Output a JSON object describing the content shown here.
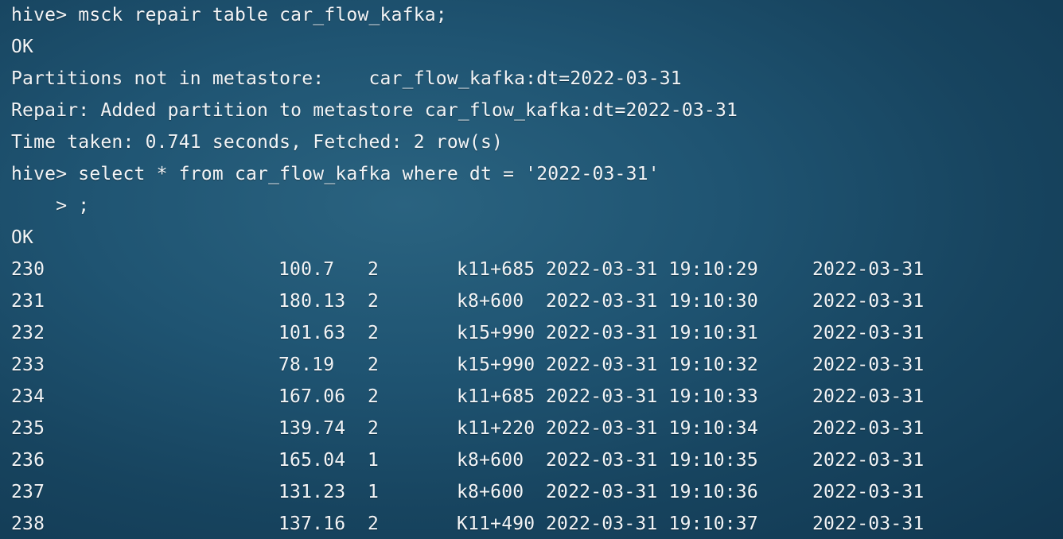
{
  "lines": [
    "hive> msck repair table car_flow_kafka;",
    "OK",
    "Partitions not in metastore:    car_flow_kafka:dt=2022-03-31",
    "Repair: Added partition to metastore car_flow_kafka:dt=2022-03-31",
    "Time taken: 0.741 seconds, Fetched: 2 row(s)",
    "hive> select * from car_flow_kafka where dt = '2022-03-31'",
    "    > ;",
    "OK"
  ],
  "rows": [
    {
      "id": "230",
      "speed": "100.7",
      "lane": "2",
      "location": "k11+685",
      "time": "2022-03-31 19:10:29",
      "dt": "2022-03-31"
    },
    {
      "id": "231",
      "speed": "180.13",
      "lane": "2",
      "location": "k8+600",
      "time": "2022-03-31 19:10:30",
      "dt": "2022-03-31"
    },
    {
      "id": "232",
      "speed": "101.63",
      "lane": "2",
      "location": "k15+990",
      "time": "2022-03-31 19:10:31",
      "dt": "2022-03-31"
    },
    {
      "id": "233",
      "speed": "78.19",
      "lane": "2",
      "location": "k15+990",
      "time": "2022-03-31 19:10:32",
      "dt": "2022-03-31"
    },
    {
      "id": "234",
      "speed": "167.06",
      "lane": "2",
      "location": "k11+685",
      "time": "2022-03-31 19:10:33",
      "dt": "2022-03-31"
    },
    {
      "id": "235",
      "speed": "139.74",
      "lane": "2",
      "location": "k11+220",
      "time": "2022-03-31 19:10:34",
      "dt": "2022-03-31"
    },
    {
      "id": "236",
      "speed": "165.04",
      "lane": "1",
      "location": "k8+600",
      "time": "2022-03-31 19:10:35",
      "dt": "2022-03-31"
    },
    {
      "id": "237",
      "speed": "131.23",
      "lane": "1",
      "location": "k8+600",
      "time": "2022-03-31 19:10:36",
      "dt": "2022-03-31"
    },
    {
      "id": "238",
      "speed": "137.16",
      "lane": "2",
      "location": "K11+490",
      "time": "2022-03-31 19:10:37",
      "dt": "2022-03-31"
    }
  ]
}
